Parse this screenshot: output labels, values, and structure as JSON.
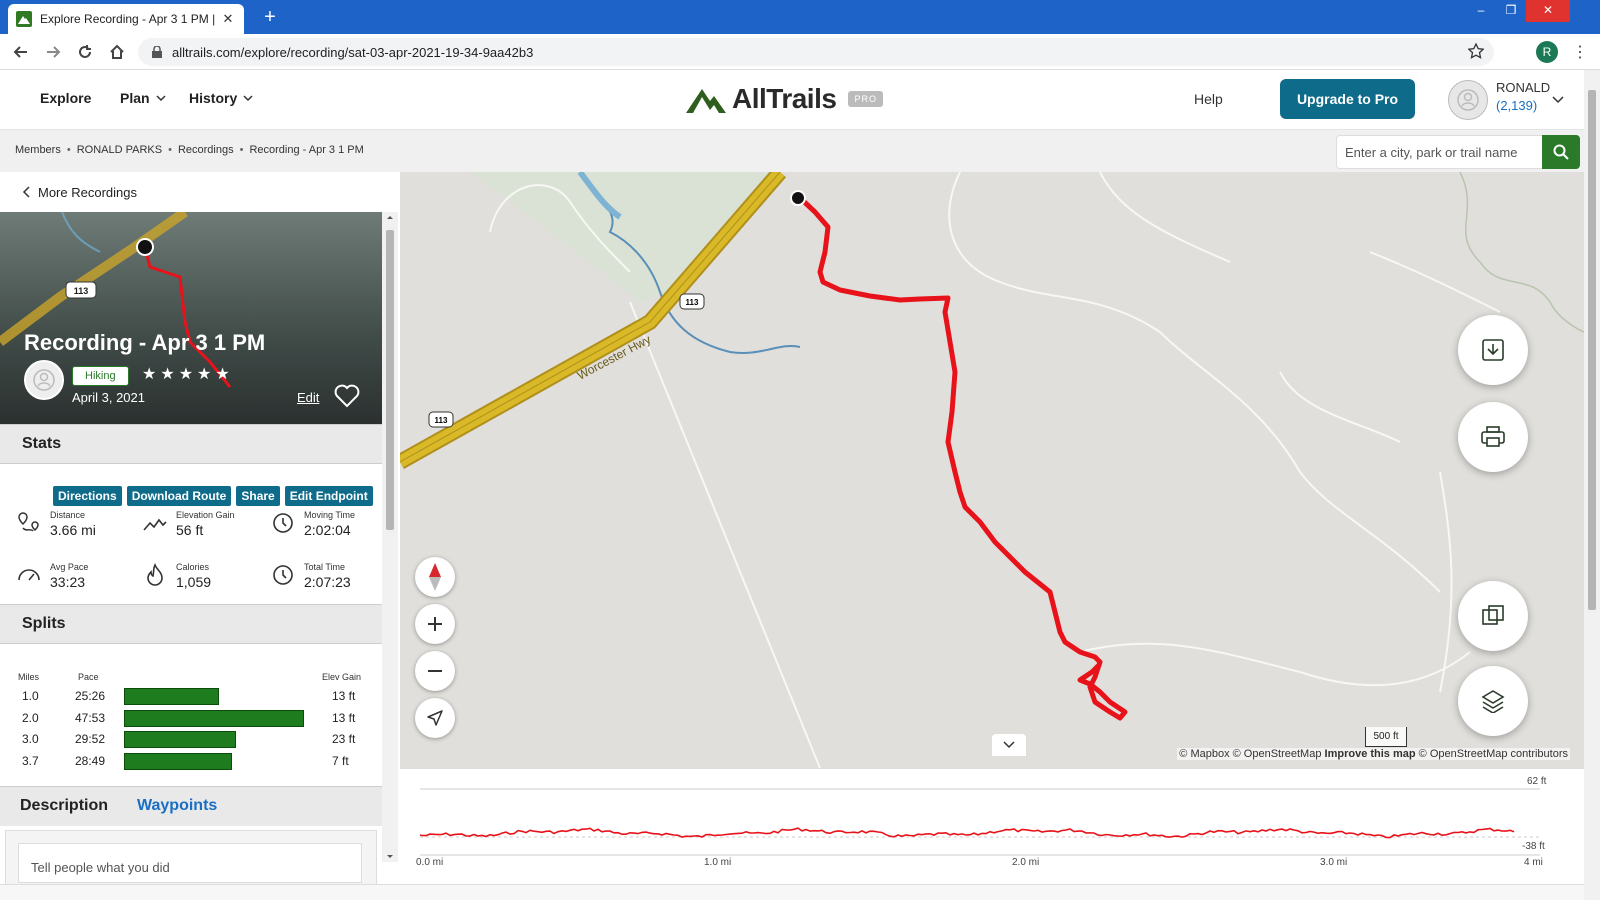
{
  "browser": {
    "tab_title": "Explore Recording - Apr 3 1 PM |",
    "url": "alltrails.com/explore/recording/sat-03-apr-2021-19-34-9aa42b3",
    "profile_initial": "R",
    "new_tab": "+",
    "close": "✕",
    "minimize": "–",
    "restore": "❐",
    "win_close": "✕"
  },
  "header": {
    "nav": [
      "Explore",
      "Plan",
      "History"
    ],
    "logo_text": "AllTrails",
    "pro_tag": "PRO",
    "help": "Help",
    "upgrade": "Upgrade to Pro",
    "user_name": "RONALD",
    "user_count": "(2,139)"
  },
  "breadcrumb": [
    "Members",
    "RONALD PARKS",
    "Recordings",
    "Recording - Apr 3 1 PM"
  ],
  "breadcrumb_sep": "•",
  "search": {
    "placeholder": "Enter a city, park or trail name"
  },
  "panel": {
    "more_recordings": "More Recordings",
    "title": "Recording - Apr 3 1 PM",
    "activity": "Hiking",
    "stars": "★★★★★",
    "rating": 0,
    "date": "April 3, 2021",
    "edit": "Edit",
    "stats_heading": "Stats",
    "actions": [
      "Directions",
      "Download Route",
      "Share",
      "Edit Endpoint"
    ],
    "stats": [
      {
        "label": "Distance",
        "value": "3.66 mi",
        "icon": "distance-icon"
      },
      {
        "label": "Elevation Gain",
        "value": "56 ft",
        "icon": "elevation-icon"
      },
      {
        "label": "Moving Time",
        "value": "2:02:04",
        "icon": "clock-icon"
      },
      {
        "label": "Avg Pace",
        "value": "33:23",
        "icon": "pace-icon"
      },
      {
        "label": "Calories",
        "value": "1,059",
        "icon": "flame-icon"
      },
      {
        "label": "Total Time",
        "value": "2:07:23",
        "icon": "clock-icon"
      }
    ],
    "splits_heading": "Splits",
    "splits_headers": {
      "miles": "Miles",
      "pace": "Pace",
      "gain": "Elev Gain"
    },
    "splits": [
      {
        "mile": "1.0",
        "pace": "25:26",
        "pace_fraction": 0.53,
        "gain": "13 ft"
      },
      {
        "mile": "2.0",
        "pace": "47:53",
        "pace_fraction": 1.0,
        "gain": "13 ft"
      },
      {
        "mile": "3.0",
        "pace": "29:52",
        "pace_fraction": 0.62,
        "gain": "23 ft"
      },
      {
        "mile": "3.7",
        "pace": "28:49",
        "pace_fraction": 0.6,
        "gain": "7 ft"
      }
    ],
    "tab_description": "Description",
    "tab_waypoints": "Waypoints",
    "description_placeholder": "Tell people what you did"
  },
  "map": {
    "road_label": "Worcester Hwy",
    "route_shield": "113",
    "scale": "500 ft",
    "attribution_1": "© Mapbox © OpenStreetMap",
    "attribution_2": "Improve this map",
    "attribution_3": "© OpenStreetMap contributors",
    "track_color": "#e8121a",
    "road_color": "#d9b928"
  },
  "elevation": {
    "max_label": "62 ft",
    "min_label": "-38 ft",
    "x_labels": [
      "0.0 mi",
      "1.0 mi",
      "2.0 mi",
      "3.0 mi",
      "4 mi"
    ]
  }
}
